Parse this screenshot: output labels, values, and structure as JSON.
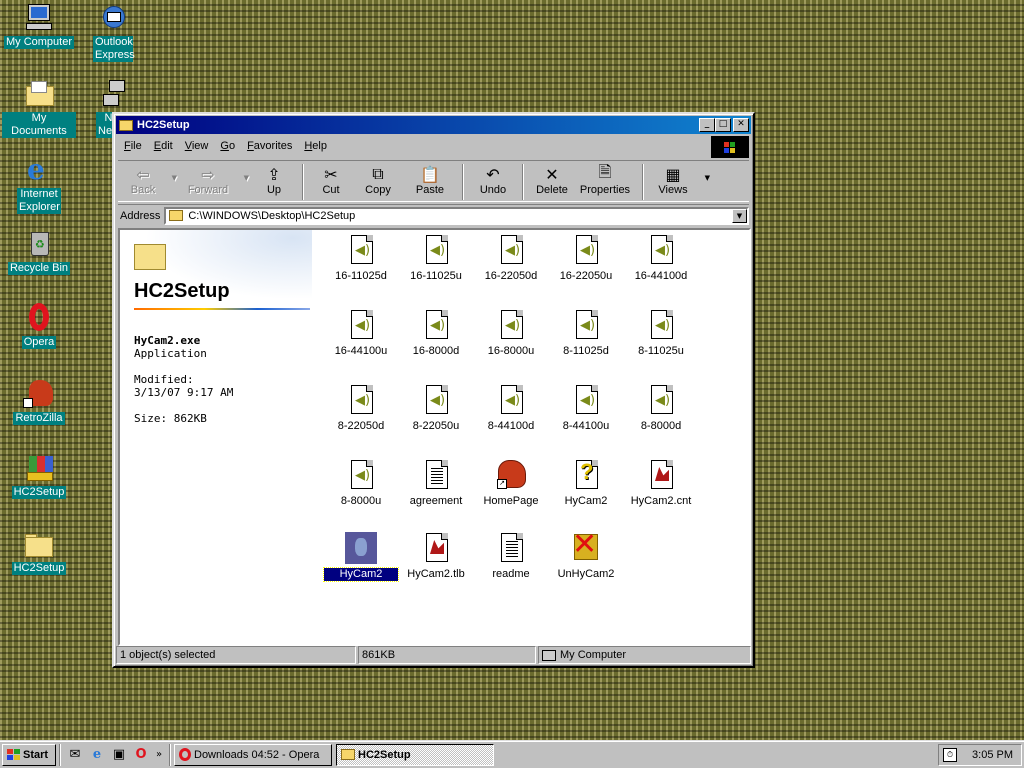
{
  "desktop": {
    "icons": [
      {
        "label": "My Computer",
        "icon": "my-computer-icon"
      },
      {
        "label": "Outlook Express",
        "icon": "outlook-express-icon"
      },
      {
        "label": "My Documents",
        "icon": "my-documents-icon"
      },
      {
        "label": "Net Neighb",
        "icon": "network-neighborhood-icon"
      },
      {
        "label": "Internet Explorer",
        "icon": "internet-explorer-icon"
      },
      {
        "label": "Recycle Bin",
        "icon": "recycle-bin-icon"
      },
      {
        "label": "Opera",
        "icon": "opera-icon"
      },
      {
        "label": "RetroZilla",
        "icon": "retrozilla-icon"
      },
      {
        "label": "HC2Setup",
        "icon": "setup-installer-icon"
      },
      {
        "label": "HC2Setup",
        "icon": "folder-icon"
      }
    ]
  },
  "window": {
    "title": "HC2Setup",
    "menu": [
      "File",
      "Edit",
      "View",
      "Go",
      "Favorites",
      "Help"
    ],
    "toolbar": {
      "back": "Back",
      "forward": "Forward",
      "up": "Up",
      "cut": "Cut",
      "copy": "Copy",
      "paste": "Paste",
      "undo": "Undo",
      "delete": "Delete",
      "properties": "Properties",
      "views": "Views"
    },
    "address": {
      "label": "Address",
      "path": "C:\\WINDOWS\\Desktop\\HC2Setup"
    },
    "panel": {
      "title": "HC2Setup",
      "file_name": "HyCam2.exe",
      "file_type": "Application",
      "modified_label": "Modified:",
      "modified_value": "3/13/07 9:17 AM",
      "size": "Size: 862KB"
    },
    "files": [
      "16-11025d",
      "16-11025u",
      "16-22050d",
      "16-22050u",
      "16-44100d",
      "16-44100u",
      "16-8000d",
      "16-8000u",
      "8-11025d",
      "8-11025u",
      "8-22050d",
      "8-22050u",
      "8-44100d",
      "8-44100u",
      "8-8000d",
      "8-8000u",
      "agreement",
      "HomePage",
      "HyCam2",
      "HyCam2.cnt",
      "HyCam2",
      "HyCam2.tlb",
      "readme",
      "UnHyCam2"
    ],
    "selected_file": "HyCam2",
    "status": {
      "selection": "1 object(s) selected",
      "size": "861KB",
      "zone": "My Computer"
    }
  },
  "taskbar": {
    "start": "Start",
    "tasks": [
      "Downloads 04:52 - Opera",
      "HC2Setup"
    ],
    "active_task": "HC2Setup",
    "clock": "3:05 PM"
  },
  "colors": {
    "title_bar": "#000080",
    "desktop_label": "#008080",
    "selection": "#000080"
  }
}
